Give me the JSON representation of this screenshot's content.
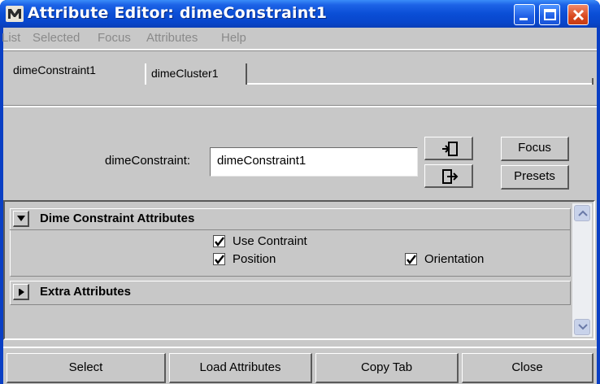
{
  "window": {
    "title": "Attribute Editor: dimeConstraint1"
  },
  "menubar": {
    "items": [
      "List",
      "Selected",
      "Focus",
      "Attributes",
      "Help"
    ]
  },
  "tabs": [
    {
      "label": "dimeConstraint1",
      "active": true
    },
    {
      "label": "dimeCluster1",
      "active": false
    }
  ],
  "node": {
    "label": "dimeConstraint:",
    "value": "dimeConstraint1",
    "focus_label": "Focus",
    "presets_label": "Presets"
  },
  "sections": [
    {
      "title": "Dime Constraint Attributes",
      "expanded": true,
      "checkboxes": [
        {
          "label": "Use Contraint",
          "checked": true
        },
        {
          "label": "Position",
          "checked": true
        },
        {
          "label": "Orientation",
          "checked": true
        }
      ]
    },
    {
      "title": "Extra Attributes",
      "expanded": false
    }
  ],
  "bottom_buttons": [
    "Select",
    "Load Attributes",
    "Copy Tab",
    "Close"
  ],
  "colors": {
    "titlebar": "#0a4ed6",
    "panel": "#c8c8c8",
    "close_button": "#d8481e"
  },
  "icons": {
    "app": "maya-logo-icon",
    "select_node": "select-node-icon",
    "goto_node": "goto-node-icon"
  }
}
